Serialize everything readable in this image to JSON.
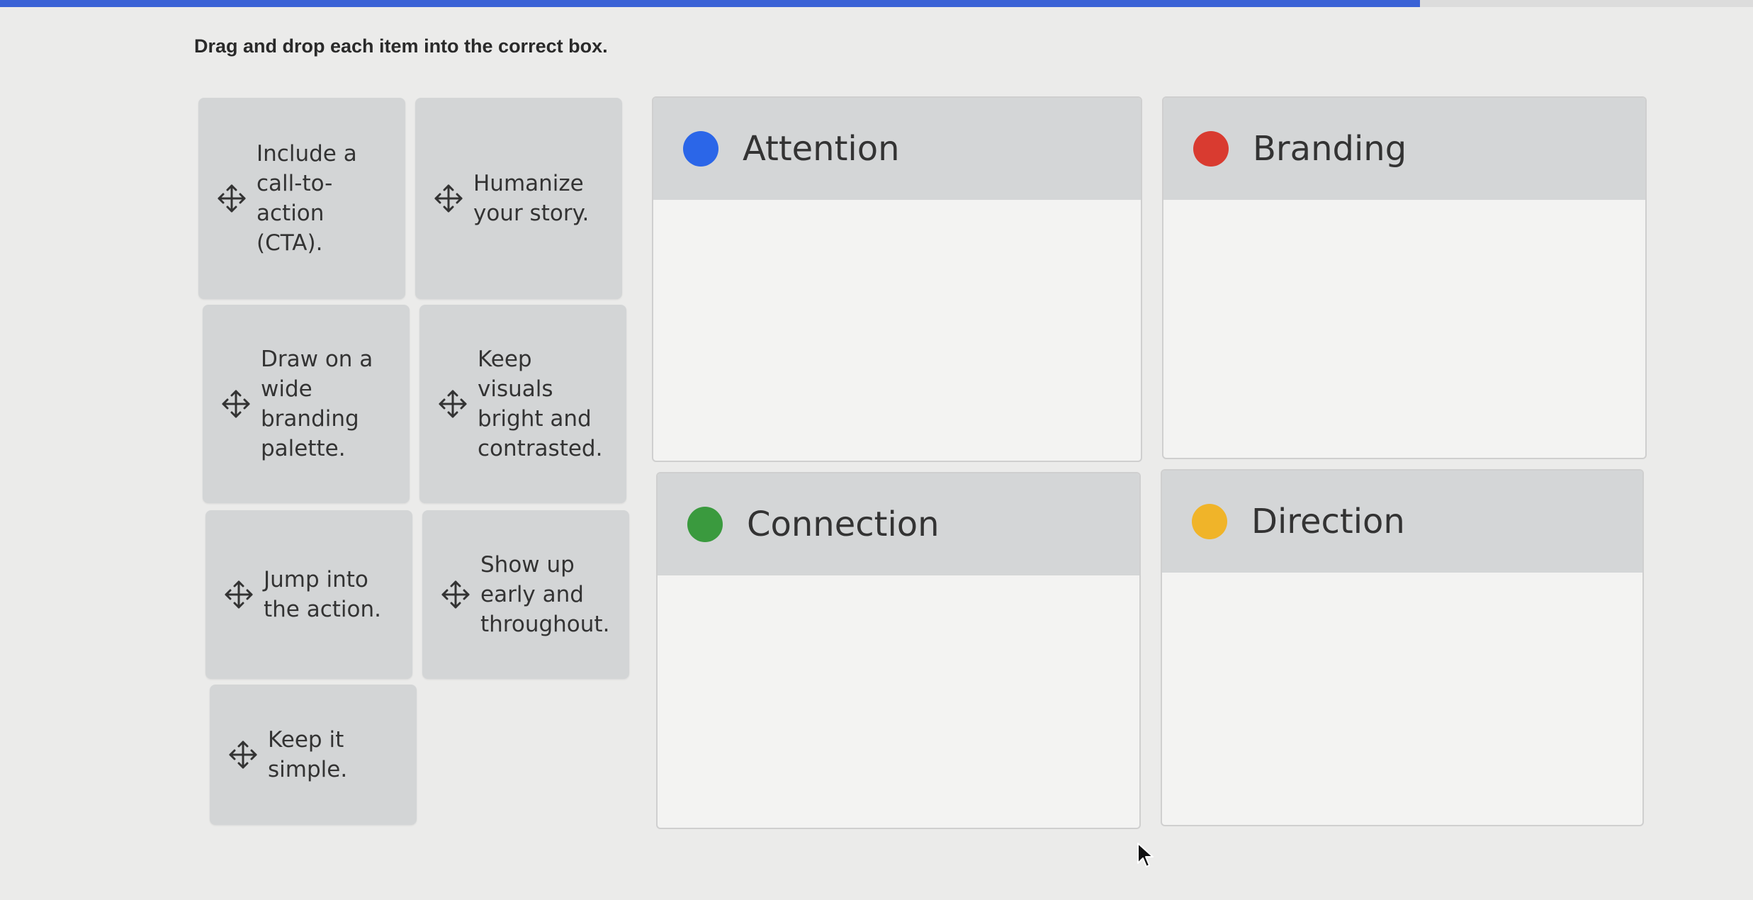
{
  "progress": {
    "percent": 81,
    "color": "#3a62d6"
  },
  "instructions": "Drag and drop each item into the correct box.",
  "cards": [
    {
      "label": "Include a call-to-action (CTA).",
      "icon": "move-icon"
    },
    {
      "label": "Humanize your story.",
      "icon": "move-icon"
    },
    {
      "label": "Draw on a wide branding palette.",
      "icon": "move-icon"
    },
    {
      "label": "Keep visuals bright and contrasted.",
      "icon": "move-icon"
    },
    {
      "label": "Jump into the action.",
      "icon": "move-icon"
    },
    {
      "label": "Show up early and throughout.",
      "icon": "move-icon"
    },
    {
      "label": "Keep it simple.",
      "icon": "move-icon"
    }
  ],
  "bins": [
    {
      "title": "Attention",
      "color": "#2b66e8"
    },
    {
      "title": "Branding",
      "color": "#d93b30"
    },
    {
      "title": "Connection",
      "color": "#3a9a3e"
    },
    {
      "title": "Direction",
      "color": "#f0b429"
    }
  ]
}
